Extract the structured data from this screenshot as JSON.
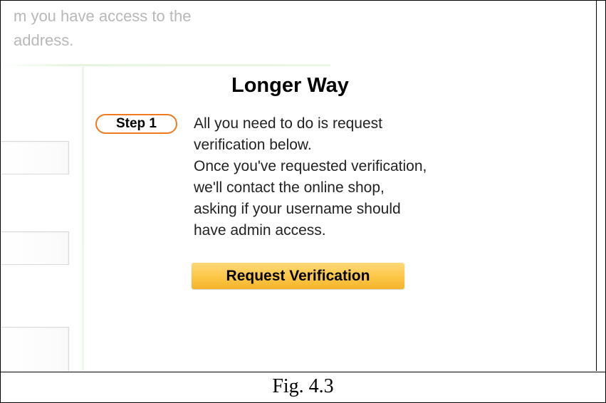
{
  "faded_intro": {
    "line1": "m you have access to the",
    "line2": "address."
  },
  "longer_way": {
    "heading": "Longer Way",
    "step_label": "Step 1",
    "body_lines": [
      "All you need to do is request",
      "verification below.",
      "Once you've requested verification,",
      "we'll contact the online shop,",
      "asking if your username should",
      "have admin access."
    ],
    "button_label": "Request Verification"
  },
  "figure": {
    "caption": "Fig. 4.3"
  },
  "colors": {
    "step_border": "#f07a20",
    "button_gradient_top": "#ffd978",
    "button_gradient_bottom": "#f4b52d",
    "divider_green": "#eaf7e4",
    "faded_text": "#b8b8b8"
  }
}
